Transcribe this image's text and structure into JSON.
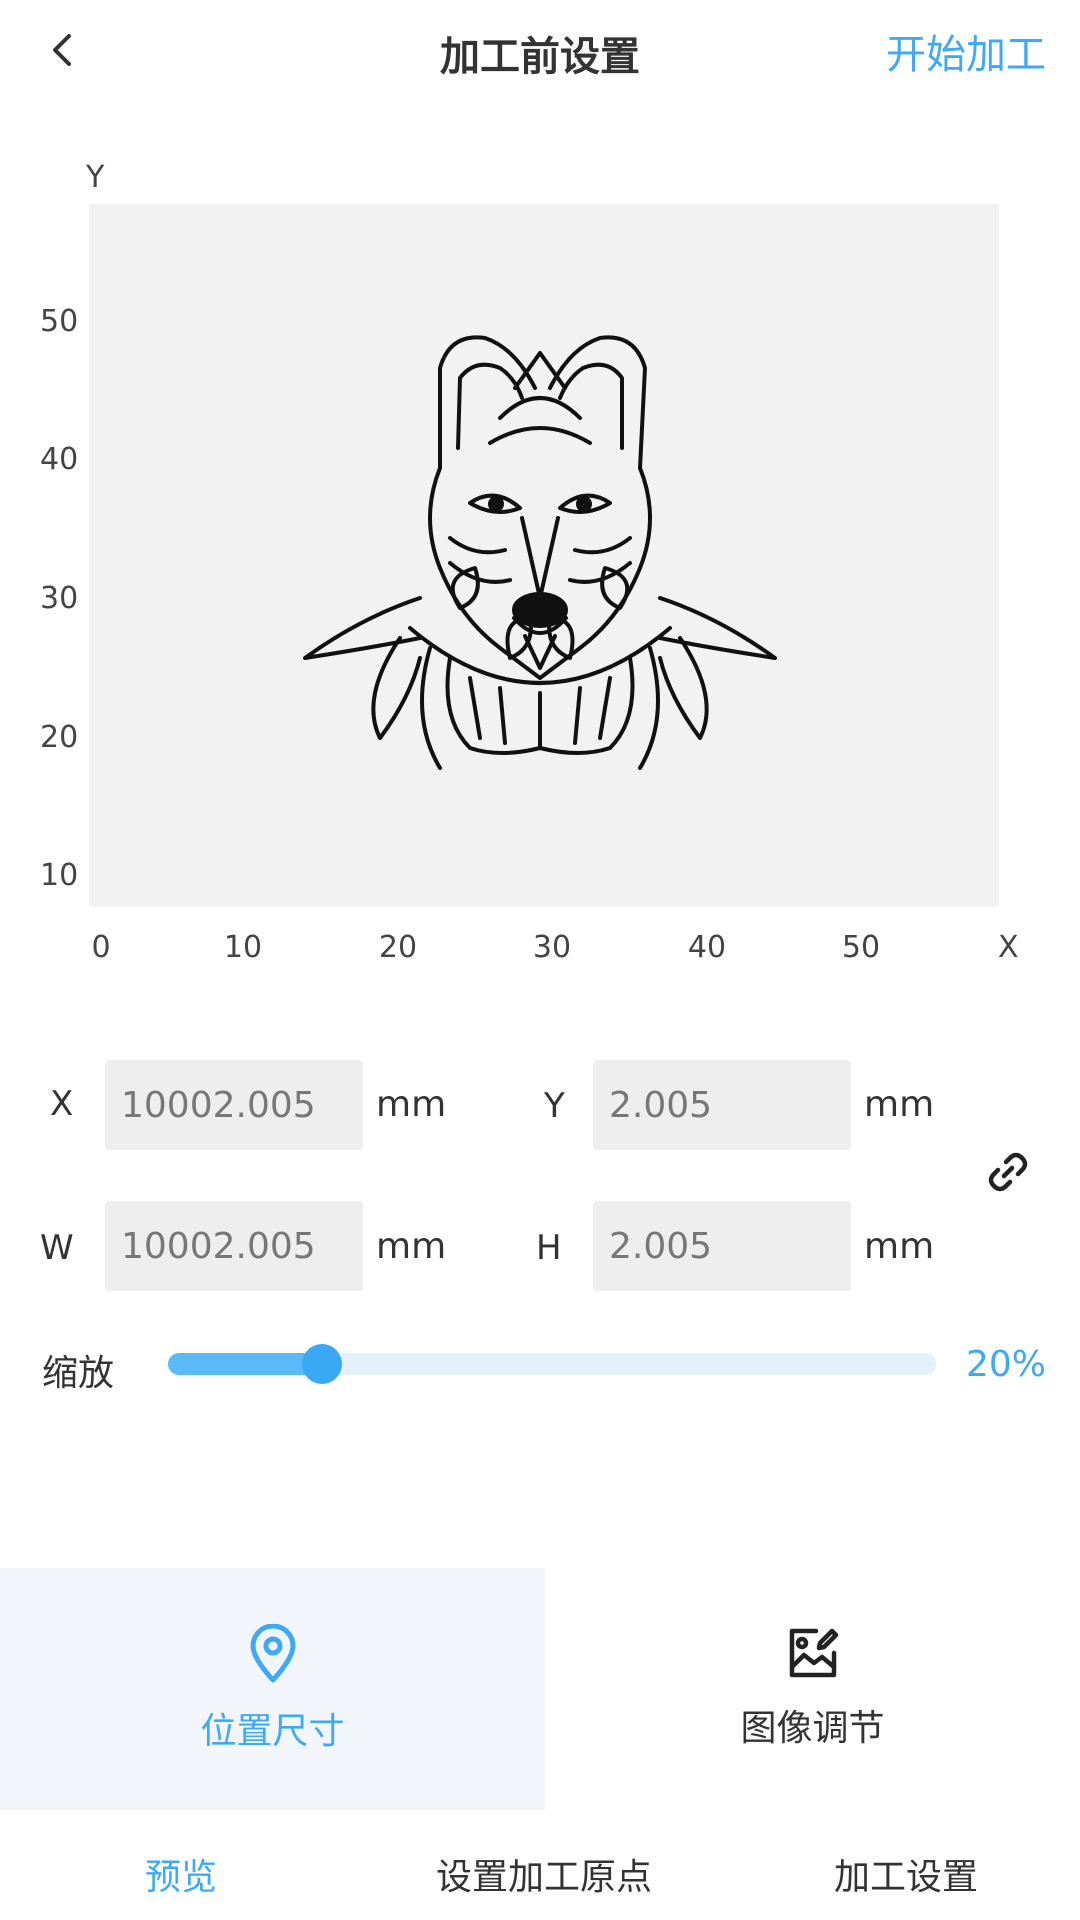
{
  "header": {
    "back_icon": "chevron-left-icon",
    "title": "加工前设置",
    "start_label": "开始加工"
  },
  "canvas": {
    "y_axis_label": "Y",
    "x_axis_label": "X",
    "y_ticks": [
      "50",
      "40",
      "30",
      "20",
      "10"
    ],
    "x_ticks": [
      "0",
      "10",
      "20",
      "30",
      "40",
      "50"
    ],
    "image_icon": "wolf-illustration",
    "background": "#f2f2f2"
  },
  "position": {
    "x_label": "X",
    "x_value": "10002.005",
    "y_label": "Y",
    "y_value": "2.005",
    "w_label": "W",
    "w_value": "10002.005",
    "h_label": "H",
    "h_value": "2.005",
    "unit": "mm",
    "link_icon": "link-icon"
  },
  "scale": {
    "label": "缩放",
    "value_text": "20%",
    "fraction": 0.2,
    "accent": "#3fa9f5"
  },
  "subtabs": [
    {
      "label": "位置尺寸",
      "icon": "location-pin-icon",
      "active": true
    },
    {
      "label": "图像调节",
      "icon": "image-edit-icon",
      "active": false
    }
  ],
  "bottom_nav": [
    {
      "label": "预览",
      "active": true
    },
    {
      "label": "设置加工原点",
      "active": false
    },
    {
      "label": "加工设置",
      "active": false
    }
  ]
}
